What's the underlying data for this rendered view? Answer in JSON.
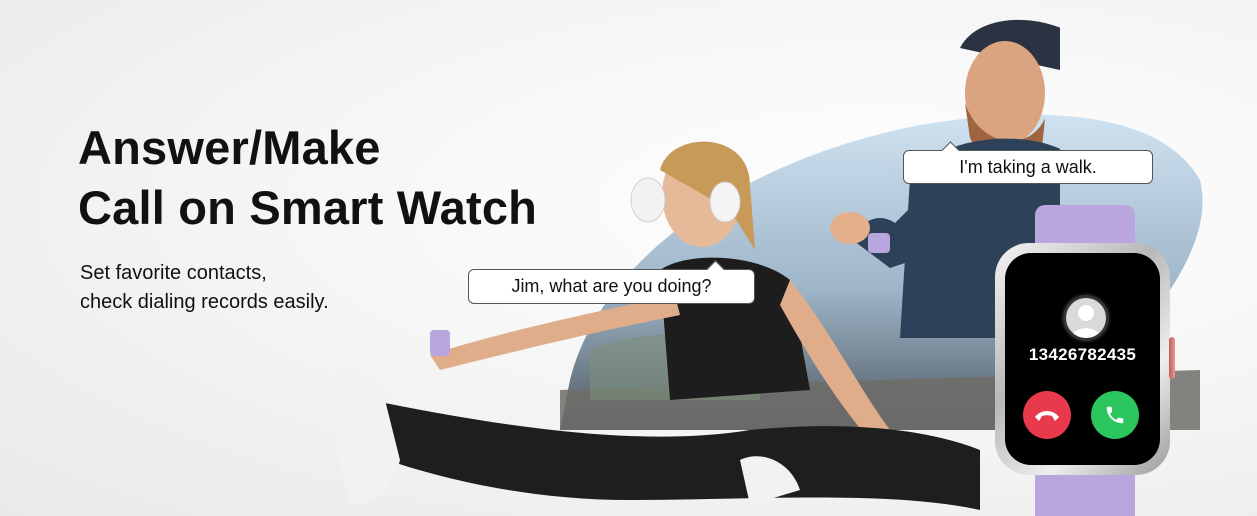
{
  "headline": {
    "line1": "Answer/Make",
    "line2": "Call on Smart Watch"
  },
  "subtext": {
    "line1": "Set favorite contacts,",
    "line2": "check dialing records easily."
  },
  "bubbles": {
    "man": "I'm taking a walk.",
    "woman": "Jim, what are you doing?"
  },
  "watch": {
    "phone_number": "13426782435",
    "strap_color": "#b9a6de",
    "accept_color": "#2bc75e",
    "decline_color": "#e83a4c",
    "icons": [
      "avatar-icon",
      "decline-call-icon",
      "accept-call-icon"
    ]
  }
}
